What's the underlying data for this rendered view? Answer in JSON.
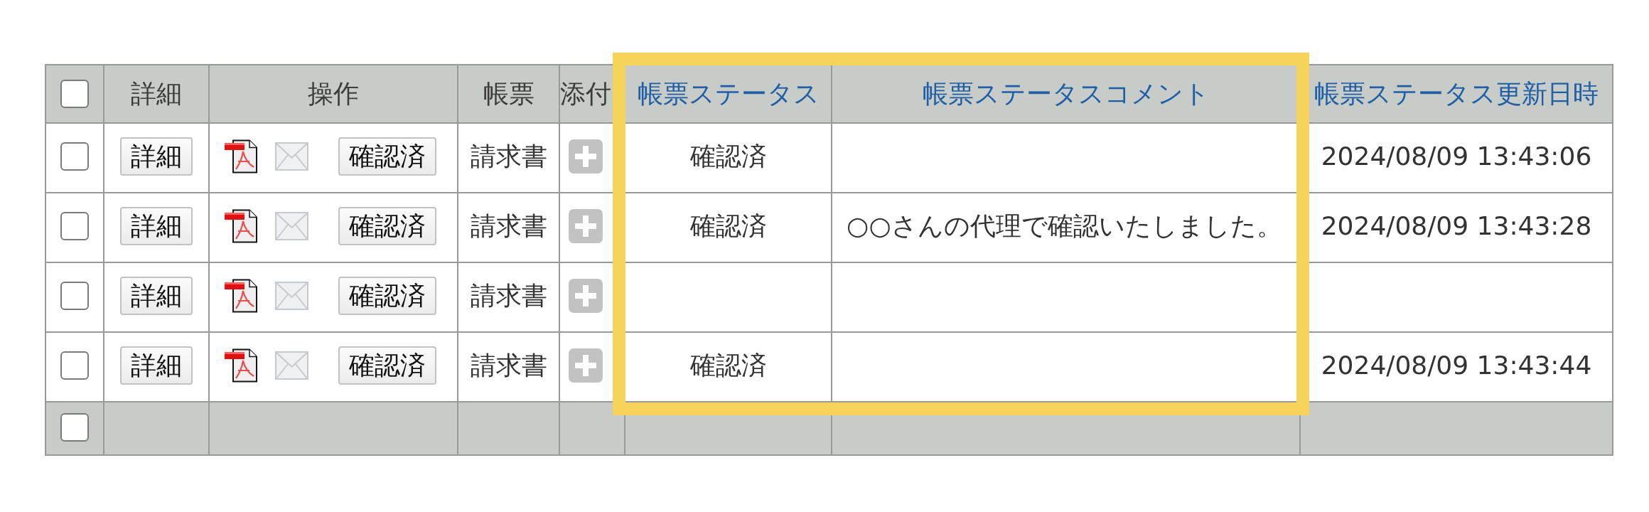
{
  "table": {
    "select_all": {
      "checked": false
    },
    "columns": [
      {
        "label": "詳細",
        "link": false,
        "highlighted": false
      },
      {
        "label": "操作",
        "link": false,
        "highlighted": false
      },
      {
        "label": "帳票",
        "link": false,
        "highlighted": false
      },
      {
        "label": "添付",
        "link": false,
        "highlighted": false
      },
      {
        "label": "帳票ステータス",
        "link": true,
        "highlighted": true
      },
      {
        "label": "帳票ステータスコメント",
        "link": true,
        "highlighted": true
      },
      {
        "label": "帳票ステータス更新日時",
        "link": true,
        "highlighted": false
      }
    ],
    "rows": [
      {
        "checked": false,
        "detail_button": "詳細",
        "confirm_button": "確認済",
        "form": "請求書",
        "status": "確認済",
        "updated": "2024/08/09 13:43:06"
      },
      {
        "checked": false,
        "detail_button": "詳細",
        "confirm_button": "確認済",
        "form": "請求書",
        "status": "確認済",
        "comment": "○○さんの代理で確認いたしました。",
        "updated": "2024/08/09 13:43:28"
      },
      {
        "checked": false,
        "detail_button": "詳細",
        "confirm_button": "確認済",
        "form": "請求書"
      },
      {
        "checked": false,
        "detail_button": "詳細",
        "confirm_button": "確認済",
        "form": "請求書",
        "status": "確認済",
        "updated": "2024/08/09 13:43:44"
      }
    ],
    "footer": {
      "checked": false
    }
  }
}
